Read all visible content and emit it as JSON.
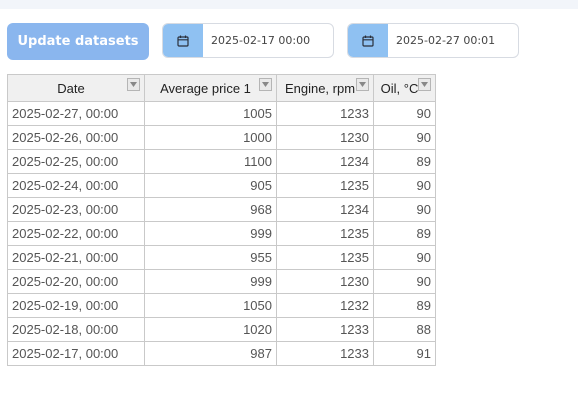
{
  "toolbar": {
    "update_label": "Update datasets",
    "date_from": "2025-02-17 00:00",
    "date_to": "2025-02-27 00:01",
    "calendar_icon": "calendar-icon"
  },
  "colors": {
    "button_bg": "#8ab6ee",
    "calendar_box": "#8fc1f2",
    "header_bg": "#f0f0f0"
  },
  "table": {
    "columns": [
      "Date",
      "Average price 1",
      "Engine, rpm",
      "Oil, °C"
    ],
    "rows": [
      [
        "2025-02-27, 00:00",
        "1005",
        "1233",
        "90"
      ],
      [
        "2025-02-26, 00:00",
        "1000",
        "1230",
        "90"
      ],
      [
        "2025-02-25, 00:00",
        "1100",
        "1234",
        "89"
      ],
      [
        "2025-02-24, 00:00",
        "905",
        "1235",
        "90"
      ],
      [
        "2025-02-23, 00:00",
        "968",
        "1234",
        "90"
      ],
      [
        "2025-02-22, 00:00",
        "999",
        "1235",
        "89"
      ],
      [
        "2025-02-21, 00:00",
        "955",
        "1235",
        "90"
      ],
      [
        "2025-02-20, 00:00",
        "999",
        "1230",
        "90"
      ],
      [
        "2025-02-19, 00:00",
        "1050",
        "1232",
        "89"
      ],
      [
        "2025-02-18, 00:00",
        "1020",
        "1233",
        "88"
      ],
      [
        "2025-02-17, 00:00",
        "987",
        "1233",
        "91"
      ]
    ]
  }
}
